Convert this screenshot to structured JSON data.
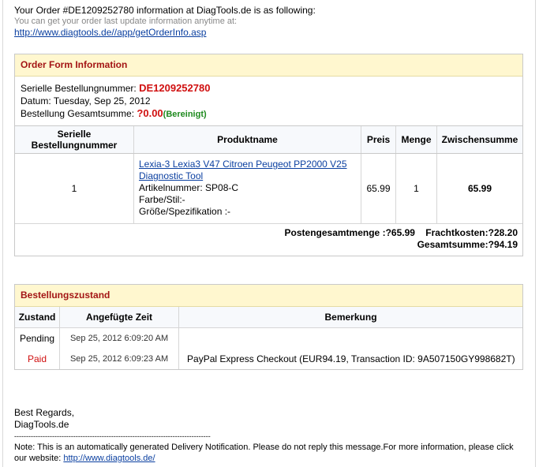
{
  "intro": {
    "line1": "Your Order #DE1209252780 information at DiagTools.de is as following:",
    "line2": "You can get your order last update information anytime at:",
    "link": "http://www.diagtools.de//app/getOrderInfo.asp"
  },
  "order_form": {
    "title": "Order Form Information",
    "order_number_label": "Serielle Bestellungnummer:",
    "order_number": "DE1209252780",
    "date_label": "Datum:",
    "date": "Tuesday, Sep 25, 2012",
    "total_label": "Bestellung Gesamtsumme:",
    "total": "?0.00",
    "total_note": "(Bereinigt)"
  },
  "items_table": {
    "headers": {
      "serial": "Serielle Bestellungnummer",
      "product": "Produktname",
      "price": "Preis",
      "qty": "Menge",
      "subtotal": "Zwischensumme"
    },
    "rows": [
      {
        "serial": "1",
        "product_link": "Lexia-3 Lexia3 V47 Citroen Peugeot PP2000 V25 Diagnostic Tool",
        "article": "Artikelnummer: SP08-C",
        "color": "Farbe/Stil:-",
        "size": "Größe/Spezifikation :-",
        "price": "65.99",
        "qty": "1",
        "subtotal": "65.99"
      }
    ],
    "totals": {
      "items_total": "Postengesamtmenge :?65.99",
      "shipping": "Frachtkosten:?28.20",
      "grand_total": "Gesamtsumme:?94.19"
    }
  },
  "status": {
    "title": "Bestellungszustand",
    "headers": {
      "state": "Zustand",
      "time": "Angefügte Zeit",
      "remark": "Bemerkung"
    },
    "rows": [
      {
        "state": "Pending",
        "time": "Sep 25, 2012  6:09:20 AM",
        "remark": ""
      },
      {
        "state": "Paid",
        "time": "Sep 25, 2012  6:09:23 AM",
        "remark": "PayPal Express Checkout (EUR94.19, Transaction ID: 9A507150GY998682T)"
      }
    ]
  },
  "footer": {
    "regards": "Best Regards,",
    "company": "DiagTools.de",
    "divider": "-----------------------------------------------------------------------------------",
    "note": "Note: This is an automatically generated Delivery Notification. Please do not reply this message.For more information, please click our website:",
    "website": "http://www.diagtools.de/"
  }
}
